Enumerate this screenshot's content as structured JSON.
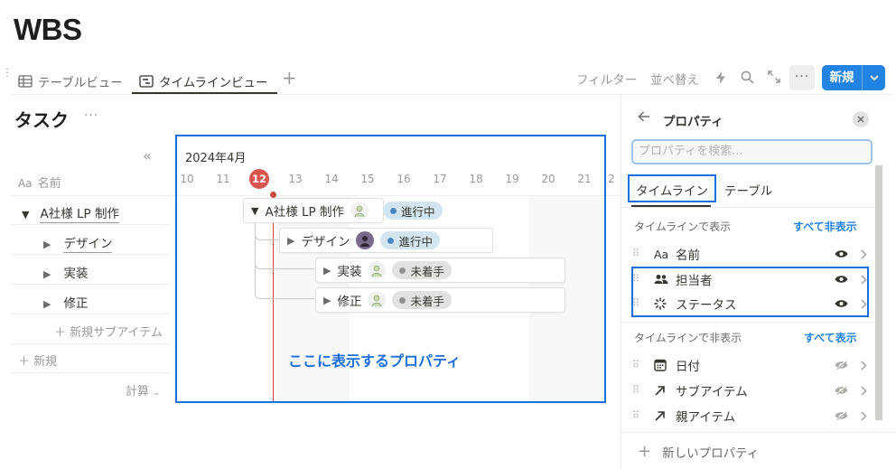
{
  "page": {
    "title": "WBS"
  },
  "views": {
    "tabs": [
      {
        "label": "テーブルビュー",
        "icon": "table-icon"
      },
      {
        "label": "タイムラインビュー",
        "icon": "timeline-icon"
      }
    ],
    "add": "+"
  },
  "toolbar": {
    "filter": "フィルター",
    "sort": "並べ替え",
    "more": "···",
    "new_label": "新規"
  },
  "database": {
    "title": "タスク",
    "more": "···",
    "collapse": "«",
    "name_header": "名前",
    "name_header_icon": "Aa",
    "rows": [
      {
        "label": "A社様 LP 制作",
        "toggle": "▼"
      },
      {
        "label": "デザイン",
        "toggle": "▶"
      },
      {
        "label": "実装",
        "toggle": "▶"
      },
      {
        "label": "修正",
        "toggle": "▶"
      }
    ],
    "new_subitem": "＋ 新規サブアイテム",
    "new_row": "＋ 新規",
    "calculate": "計算"
  },
  "timeline": {
    "month": "2024年4月",
    "days": [
      "10",
      "11",
      "12",
      "13",
      "14",
      "15",
      "16",
      "17",
      "18",
      "19",
      "20",
      "21",
      "2"
    ],
    "today": "12",
    "items": [
      {
        "label": "A社様 LP 制作",
        "toggle": "▼",
        "status": "進行中",
        "status_color": "#5592c4"
      },
      {
        "label": "デザイン",
        "toggle": "▶",
        "status": "進行中",
        "status_color": "#5592c4"
      },
      {
        "label": "実装",
        "toggle": "▶",
        "status": "未着手",
        "status_color": "#91918e"
      },
      {
        "label": "修正",
        "toggle": "▶",
        "status": "未着手",
        "status_color": "#91918e"
      }
    ],
    "annotation": "ここに表示するプロパティ"
  },
  "properties_panel": {
    "title": "プロパティ",
    "search_placeholder": "プロパティを検索...",
    "tabs": [
      "タイムライン",
      "テーブル"
    ],
    "shown_label": "タイムラインで表示",
    "hide_all": "すべて非表示",
    "shown": [
      {
        "name": "名前",
        "icon": "Aa"
      },
      {
        "name": "担当者",
        "icon": "people-icon"
      },
      {
        "name": "ステータス",
        "icon": "status-icon"
      }
    ],
    "hidden_label": "タイムラインで非表示",
    "show_all": "すべて表示",
    "hidden": [
      {
        "name": "日付",
        "icon": "calendar-icon"
      },
      {
        "name": "サブアイテム",
        "icon": "relation-arrow-icon"
      },
      {
        "name": "親アイテム",
        "icon": "relation-arrow-icon"
      }
    ],
    "new_property": "新しいプロパティ"
  }
}
